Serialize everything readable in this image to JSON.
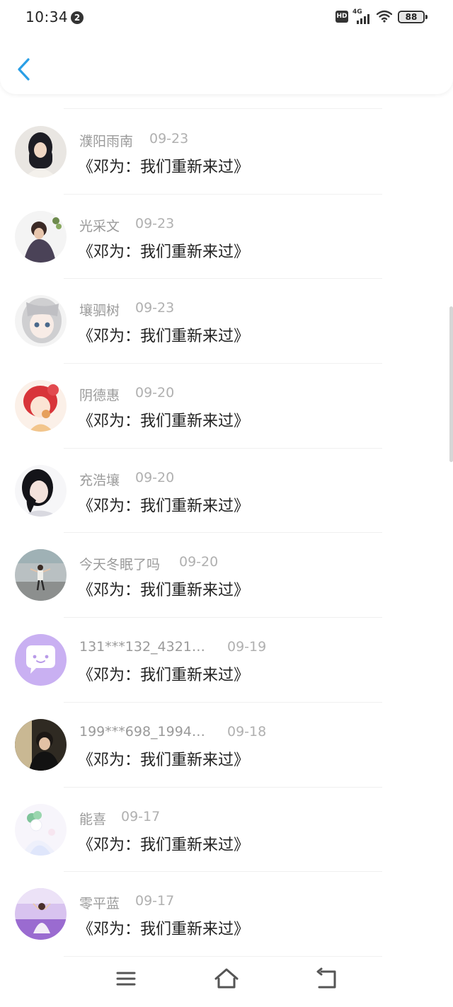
{
  "status_bar": {
    "time": "10:34",
    "notification_count": "2",
    "network": "4G",
    "hd": "HD",
    "battery": "88"
  },
  "colors": {
    "accent": "#2a9fe6",
    "name": "#9a9a9a",
    "date": "#b0b0b0",
    "title": "#222222"
  },
  "header": {
    "back_icon": "chevron-left-icon"
  },
  "comments": [
    {
      "name": "濮阳雨南",
      "date": "09-23",
      "title": "《邓为：我们重新来过》"
    },
    {
      "name": "光采文",
      "date": "09-23",
      "title": "《邓为：我们重新来过》"
    },
    {
      "name": "壤驷树",
      "date": "09-23",
      "title": "《邓为：我们重新来过》"
    },
    {
      "name": "阴德惠",
      "date": "09-20",
      "title": "《邓为：我们重新来过》"
    },
    {
      "name": "充浩壤",
      "date": "09-20",
      "title": "《邓为：我们重新来过》"
    },
    {
      "name": "今天冬眠了吗",
      "date": "09-20",
      "title": "《邓为：我们重新来过》"
    },
    {
      "name": "131***132_4321…",
      "date": "09-19",
      "title": "《邓为：我们重新来过》"
    },
    {
      "name": "199***698_1994…",
      "date": "09-18",
      "title": "《邓为：我们重新来过》"
    },
    {
      "name": "能喜",
      "date": "09-17",
      "title": "《邓为：我们重新来过》"
    },
    {
      "name": "零平蓝",
      "date": "09-17",
      "title": "《邓为：我们重新来过》"
    }
  ],
  "navbar": {
    "menu_icon": "menu-icon",
    "home_icon": "home-icon",
    "back_icon": "back-icon"
  }
}
